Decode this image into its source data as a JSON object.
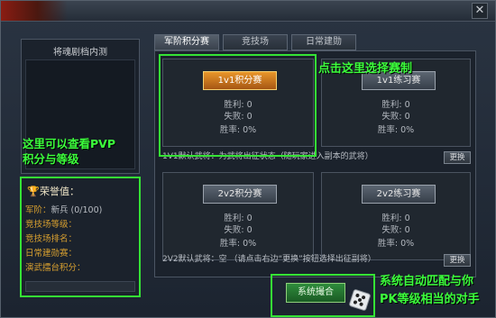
{
  "window": {
    "close_label": "✕"
  },
  "left_panel": {
    "title": "将魂剧档内测"
  },
  "annotations": {
    "pvp_note_line1": "这里可以查看PVP",
    "pvp_note_line2": "积分与等级",
    "select_note": "点击这里选择赛制",
    "match_note_line1": "系统自动匹配与你",
    "match_note_line2": "PK等级相当的对手"
  },
  "honor": {
    "header": "荣誉值：",
    "rows": [
      {
        "label": "军阶：",
        "value": "新兵 (0/100)"
      },
      {
        "label": "竞技场等级：",
        "value": ""
      },
      {
        "label": "竞技场排名：",
        "value": ""
      },
      {
        "label": "日常建勋赛：",
        "value": ""
      },
      {
        "label": "演武擂台积分：",
        "value": ""
      }
    ]
  },
  "tabs": [
    {
      "label": "军阶积分赛",
      "active": true
    },
    {
      "label": "竞技场",
      "active": false
    },
    {
      "label": "日常建勋",
      "active": false
    }
  ],
  "slots": {
    "rank_1v1": {
      "button": "1v1积分赛",
      "wins": "胜利: 0",
      "losses": "失败: 0",
      "rate": "胜率: 0%"
    },
    "practice_1v1": {
      "button": "1v1练习赛",
      "wins": "胜利: 0",
      "losses": "失败: 0",
      "rate": "胜率: 0%"
    },
    "rank_2v2": {
      "button": "2v2积分赛",
      "wins": "胜利: 0",
      "losses": "失败: 0",
      "rate": "胜率: 0%"
    },
    "practice_2v2": {
      "button": "2v2练习赛",
      "wins": "胜利: 0",
      "losses": "失败: 0",
      "rate": "胜率: 0%"
    }
  },
  "info": {
    "line_1v1": "1V1默认武将：为武将出征状态（随玩家进入副本的武将）",
    "line_2v2": "2V2默认武将：空 （请点击右边“更换”按钮选择出征副将）",
    "change_label": "更换"
  },
  "match_button": {
    "label": "系统撮合"
  },
  "colors": {
    "annotation": "#3cff3c",
    "selected_button": "#e8962a",
    "honor_label": "#d8a030"
  }
}
